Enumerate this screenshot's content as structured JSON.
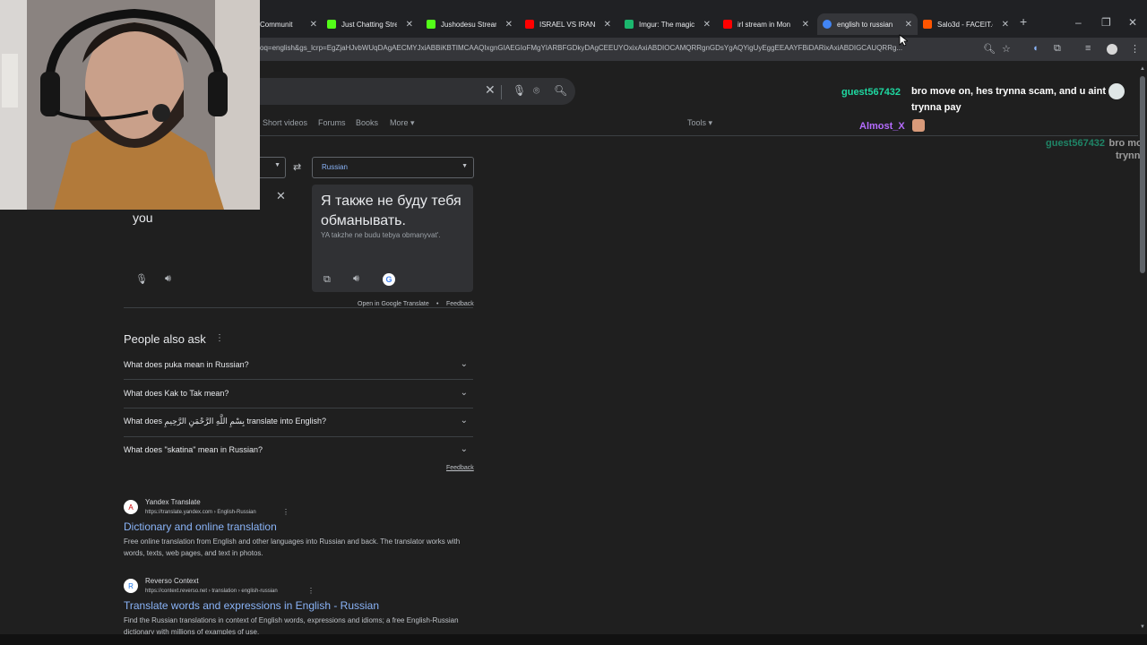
{
  "tabs": [
    {
      "title": "Communit",
      "color": "#9146ff"
    },
    {
      "title": "Just Chatting Stre",
      "color": "#53fc18"
    },
    {
      "title": "Jushodesu Stream",
      "color": "#53fc18"
    },
    {
      "title": "ISRAEL VS IRAN -",
      "color": "#ff0000"
    },
    {
      "title": "Imgur: The magic",
      "color": "#1bb76e"
    },
    {
      "title": "irl stream in Mon",
      "color": "#ff0000"
    },
    {
      "title": "english to russian",
      "color": "#4285f4"
    },
    {
      "title": "Salo3d - FACEIT.c",
      "color": "#ff5500"
    }
  ],
  "address_url": "oq=english&gs_lcrp=EgZjaHJvbWUqDAgAECMYJxiABBiKBTIMCAAQIxgnGIAEGIoFMgYIARBFGDkyDAgCEEUYOxixAxiABDIOCAMQRRgnGDsYgAQYigUyEggEEAAYFBiDARixAxiABDIGCAUQRRg...",
  "search": {
    "clear": "✕"
  },
  "filters": [
    "Short videos",
    "Forums",
    "Books",
    "More",
    "Tools"
  ],
  "translate": {
    "source_lang": "",
    "target_lang": "Russian",
    "source_text": "you",
    "output_text": "Я также не буду тебя обманывать.",
    "translit": "YA takzhe ne budu tebya obmanyvat'.",
    "open_link": "Open in Google Translate",
    "sep": "•",
    "feedback": "Feedback"
  },
  "paa": {
    "heading": "People also ask",
    "questions": [
      "What does puka mean in Russian?",
      "What does Kak to Tak mean?",
      "What does بِسْمِ اللَّهِ الرَّحْمَنِ الرَّحِيمِ translate into English?",
      "What does \"skatina\" mean in Russian?"
    ],
    "feedback": "Feedback"
  },
  "results": [
    {
      "site": "Yandex Translate",
      "url": "https://translate.yandex.com › English-Russian",
      "title": "Dictionary and online translation",
      "snippet": "Free online translation from English and other languages into Russian and back. The translator works with words, texts, web pages, and text in photos.",
      "icon": "A"
    },
    {
      "site": "Reverso Context",
      "url": "https://context.reverso.net › translation › english-russian",
      "title": "Translate words and expressions in English - Russian",
      "snippet": "Find the Russian translations in context of English words, expressions and idioms; a free English-Russian dictionary with millions of examples of use.",
      "icon": "R"
    }
  ],
  "chat": [
    {
      "user": "guest567432",
      "msg": "bro move on, hes trynna scam, and u aint trynna pay",
      "color": "#1fd7a0"
    },
    {
      "user": "Almost_X",
      "msg": "",
      "color": "#b56cff"
    },
    {
      "user": "guest567432",
      "msg": "bro mo",
      "color": "#1fd7a0"
    },
    {
      "user": "",
      "msg": "trynn",
      "color": "#1fd7a0"
    }
  ]
}
